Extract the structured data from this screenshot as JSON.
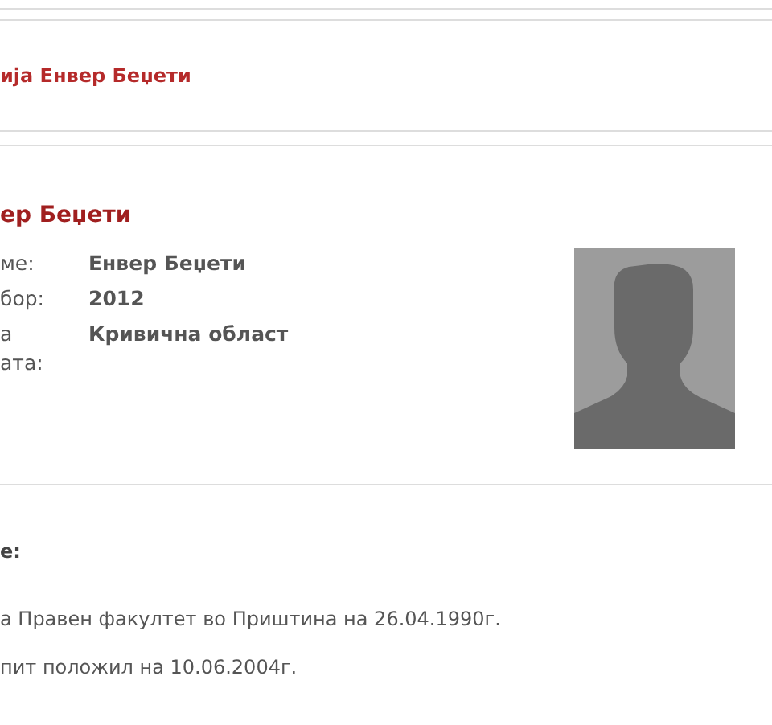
{
  "breadcrumb": "ија Енвер Беџети",
  "heading": "ер Беџети",
  "details": [
    {
      "label": "ме:",
      "value": "Енвер Беџети"
    },
    {
      "label": "бор:",
      "value": "2012"
    },
    {
      "label": "а\nата:",
      "value": "Кривична област"
    }
  ],
  "section_label": "е:",
  "paragraphs": [
    "а Правен факултет во Приштина на 26.04.1990г.",
    "пит положил на 10.06.2004г."
  ]
}
